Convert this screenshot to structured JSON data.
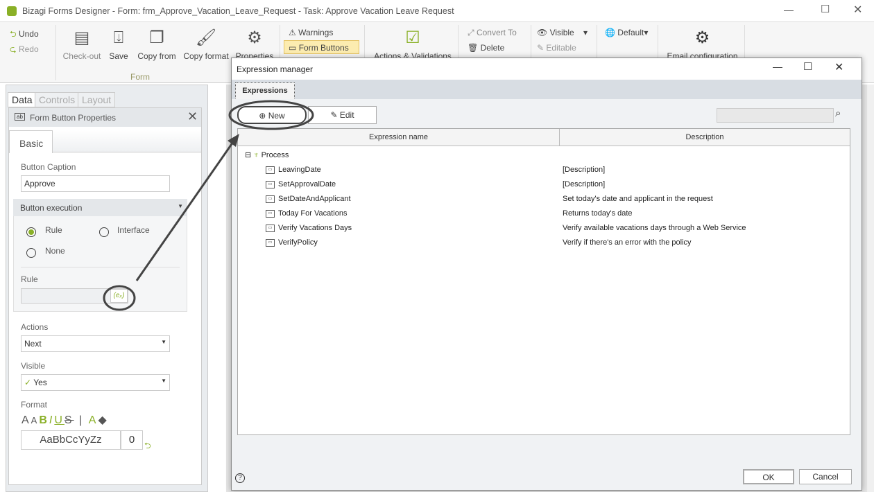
{
  "window": {
    "title": "Bizagi Forms Designer  - Form: frm_Approve_Vacation_Leave_Request - Task:  Approve Vacation Leave Request"
  },
  "ribbon": {
    "undo": "Undo",
    "redo": "Redo",
    "checkout": "Check-out",
    "save": "Save",
    "copy_from": "Copy from",
    "copy_format": "Copy format",
    "properties": "Properties",
    "group_form": "Form",
    "warnings": "Warnings",
    "form_buttons": "Form Buttons",
    "actions_validations": "Actions & Validations",
    "convert_to": "Convert To",
    "delete": "Delete",
    "visible": "Visible",
    "editable": "Editable",
    "default": "Default",
    "email_config": "Email configuration"
  },
  "left": {
    "tabs": [
      "Data",
      "Controls",
      "Layout"
    ],
    "panel_title": "Form Button Properties",
    "basic_tab": "Basic",
    "button_caption_label": "Button Caption",
    "button_caption_value": "Approve",
    "button_execution": "Button execution",
    "radio_rule": "Rule",
    "radio_interface": "Interface",
    "radio_none": "None",
    "rule_label": "Rule",
    "actions_label": "Actions",
    "actions_value": "Next",
    "visible_label": "Visible",
    "visible_value": "Yes",
    "format_label": "Format",
    "format_preview": "AaBbCcYyZz",
    "format_size": "0",
    "selected_execution": "Rule"
  },
  "dialog": {
    "title": "Expression manager",
    "tab": "Expressions",
    "new": "New",
    "edit": "Edit",
    "col_name": "Expression name",
    "col_desc": "Description",
    "root": "Process",
    "rows": [
      {
        "name": "LeavingDate",
        "desc": "[Description]"
      },
      {
        "name": "SetApprovalDate",
        "desc": "[Description]"
      },
      {
        "name": "SetDateAndApplicant",
        "desc": "Set today's date and applicant in the request"
      },
      {
        "name": "Today For Vacations",
        "desc": "Returns today's date"
      },
      {
        "name": "Verify Vacations Days",
        "desc": "Verify available vacations days through a Web Service"
      },
      {
        "name": "VerifyPolicy",
        "desc": "Verify if there's an error with the policy"
      }
    ],
    "ok": "OK",
    "cancel": "Cancel",
    "help": "?"
  },
  "colors": {
    "accent": "#8ab027",
    "highlight": "#fcecb0"
  }
}
